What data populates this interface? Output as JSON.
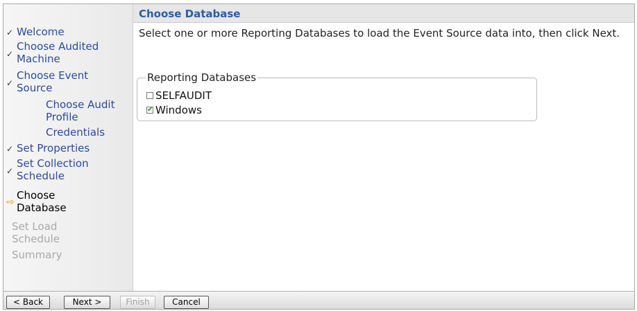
{
  "sidebar": {
    "steps": [
      {
        "label": "Welcome",
        "state": "done"
      },
      {
        "label": "Choose Audited",
        "label2": "Machine",
        "state": "done"
      },
      {
        "label": "Choose Event",
        "label2": "Source",
        "state": "done"
      },
      {
        "label": "Choose Audit",
        "label2": "Profile",
        "state": "substep"
      },
      {
        "label": "Credentials",
        "state": "substep"
      },
      {
        "label": "Set Properties",
        "state": "done"
      },
      {
        "label": "Set Collection",
        "label2": "Schedule",
        "state": "done"
      },
      {
        "label": "Choose",
        "label2": "Database",
        "state": "current"
      },
      {
        "label": "Set Load",
        "label2": "Schedule",
        "state": "pending"
      },
      {
        "label": "Summary",
        "state": "pending"
      }
    ],
    "check_glyph": "✓",
    "arrow_glyph": "⇨"
  },
  "main": {
    "title": "Choose Database",
    "instruction": "Select one or more Reporting Databases to load the Event Source data into, then click Next.",
    "group_label": "Reporting Databases",
    "options": [
      {
        "label": "SELFAUDIT",
        "checked": false
      },
      {
        "label": "Windows",
        "checked": true
      }
    ]
  },
  "footer": {
    "back": "< Back",
    "next": "Next >",
    "finish": "Finish",
    "cancel": "Cancel"
  },
  "colors": {
    "link_blue": "#2a4a9e",
    "title_blue": "#2a5ca8",
    "disabled_gray": "#a9a9a9",
    "current_arrow": "#e3a400",
    "check_green": "#2a8a2a"
  }
}
